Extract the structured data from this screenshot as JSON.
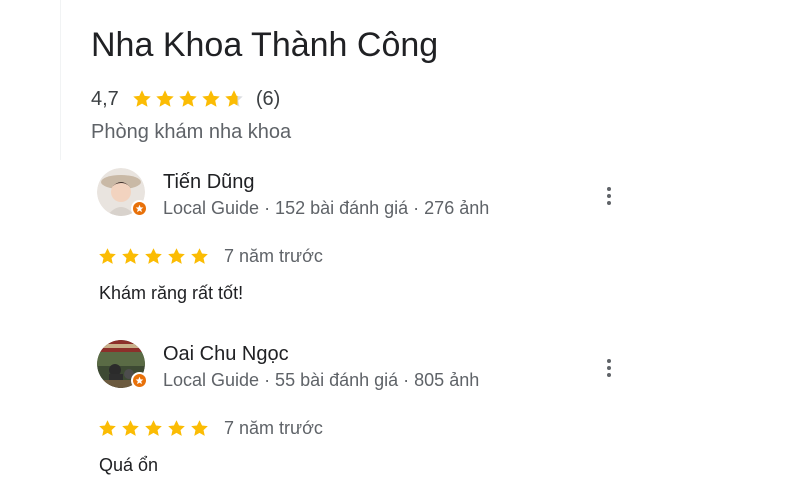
{
  "place": {
    "title": "Nha Khoa Thành Công",
    "rating": "4,7",
    "rating_value": 4.7,
    "review_count": "(6)",
    "category": "Phòng khám nha khoa"
  },
  "colors": {
    "star": "#fbbc04",
    "star_empty": "#dadce0",
    "local_guide_badge": "#e8710a"
  },
  "reviews": [
    {
      "name": "Tiến Dũng",
      "meta": "Local Guide · 152 bài đánh giá · 276 ảnh",
      "stars": 5,
      "time": "7 năm trước",
      "text": "Khám răng rất tốt!"
    },
    {
      "name": "Oai Chu Ngọc",
      "meta": "Local Guide · 55 bài đánh giá · 805 ảnh",
      "stars": 5,
      "time": "7 năm trước",
      "text": "Quá ổn"
    }
  ],
  "icons": {
    "more": "more-vert-icon",
    "star": "star-icon",
    "badge": "local-guide-badge-icon"
  }
}
